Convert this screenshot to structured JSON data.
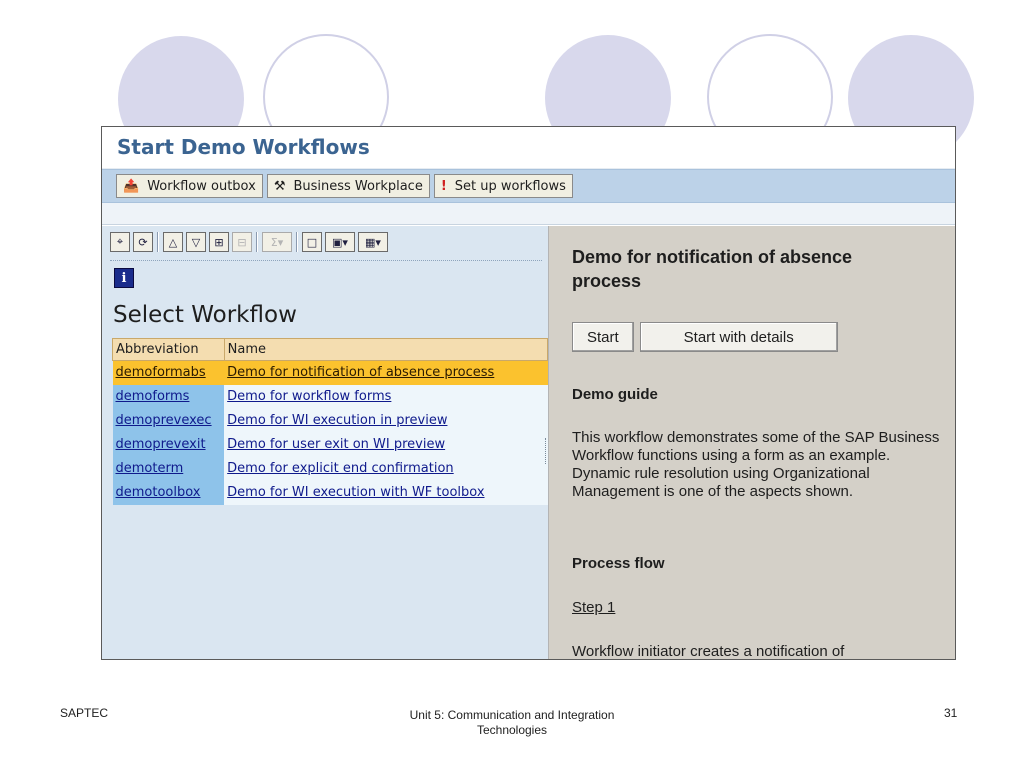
{
  "app": {
    "title": "Start Demo Workflows",
    "toolbar": [
      {
        "label": "Workflow outbox",
        "icon": "outbox-icon"
      },
      {
        "label": "Business Workplace",
        "icon": "workplace-icon"
      },
      {
        "label": "Set up workflows",
        "icon": "setup-icon"
      }
    ]
  },
  "list": {
    "title": "Select Workflow",
    "columns": [
      "Abbreviation",
      "Name"
    ],
    "rows": [
      {
        "abbr": "demoformabs",
        "name": "Demo for notification of absence process",
        "selected": true
      },
      {
        "abbr": "demoforms",
        "name": "Demo for workflow forms"
      },
      {
        "abbr": "demoprevexec",
        "name": "Demo for WI execution in preview"
      },
      {
        "abbr": "demoprevexit",
        "name": "Demo for user exit on WI preview"
      },
      {
        "abbr": "demoterm",
        "name": "Demo for explicit end confirmation"
      },
      {
        "abbr": "demotoolbox",
        "name": "Demo for WI execution with WF toolbox"
      }
    ]
  },
  "detail": {
    "title": "Demo for notification of absence process",
    "start_label": "Start",
    "start_details_label": "Start with details",
    "guide_heading": "Demo guide",
    "guide_text": "This workflow demonstrates some of the SAP Business Workflow functions using a form as an example. Dynamic rule resolution using Organizational Management is one of the aspects shown.",
    "process_heading": "Process flow",
    "step_link": "Step 1",
    "step_text": "Workflow initiator creates a notification of"
  },
  "footer": {
    "left": "SAPTEC",
    "center_line1": "Unit 5: Communication and Integration",
    "center_line2": "Technologies",
    "page": "31"
  },
  "colors": {
    "title": "#3b6491",
    "toolbar_bg": "#bcd2e8",
    "selected_row": "#fbc22e",
    "abbr_cell": "#8ec3ea",
    "detail_bg": "#d4d0c8",
    "deco_circle": "#d8d8ec"
  }
}
